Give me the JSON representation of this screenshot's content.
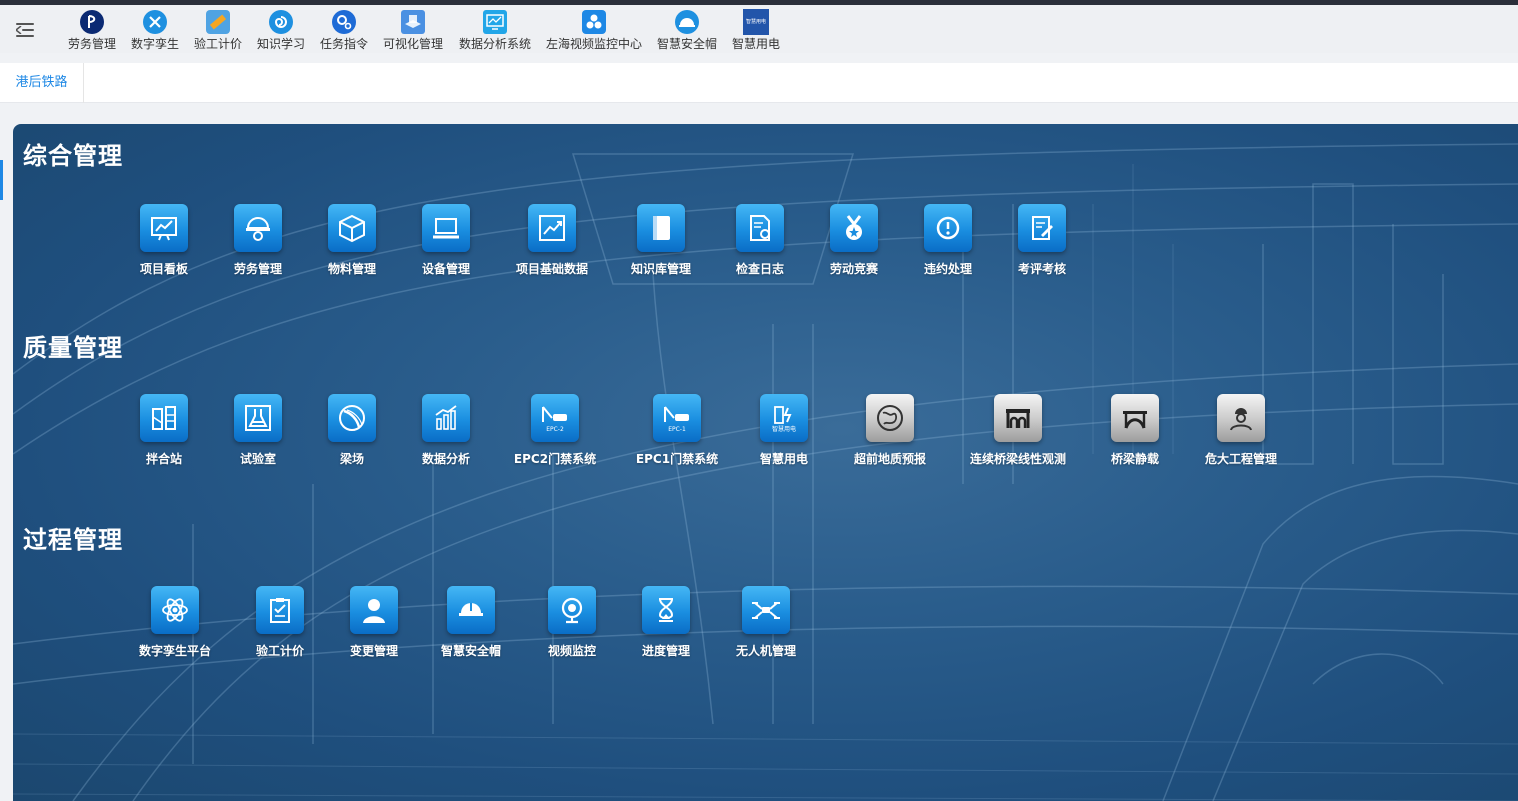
{
  "nav": {
    "items": [
      {
        "label": "劳务管理",
        "icon": "playstation-icon",
        "color": "#0b2a73"
      },
      {
        "label": "数字孪生",
        "icon": "tools-icon",
        "color": "#1e90e0"
      },
      {
        "label": "验工计价",
        "icon": "pencil-ruler-icon",
        "color": "#f5a623"
      },
      {
        "label": "知识学习",
        "icon": "spiral-icon",
        "color": "#1e90e0"
      },
      {
        "label": "任务指令",
        "icon": "gears-icon",
        "color": "#1e6bd6"
      },
      {
        "label": "可视化管理",
        "icon": "cube-city-icon",
        "color": "#4a90e2"
      },
      {
        "label": "数据分析系统",
        "icon": "monitor-chart-icon",
        "color": "#22a6e8"
      },
      {
        "label": "左海视频监控中心",
        "icon": "circles-icon",
        "color": "#1e88e5"
      },
      {
        "label": "智慧安全帽",
        "icon": "helmet-icon",
        "color": "#1e90e0"
      },
      {
        "label": "智慧用电",
        "icon": "power-logo-icon",
        "color": "#2255aa",
        "logo_text": "智慧用电"
      }
    ]
  },
  "tabs": [
    {
      "label": "港后铁路"
    }
  ],
  "sections": [
    {
      "title": "综合管理",
      "apps": [
        {
          "label": "项目看板",
          "icon": "presentation-chart-icon"
        },
        {
          "label": "劳务管理",
          "icon": "worker-helmet-icon"
        },
        {
          "label": "物料管理",
          "icon": "box-icon"
        },
        {
          "label": "设备管理",
          "icon": "laptop-icon"
        },
        {
          "label": "项目基础数据",
          "icon": "trend-chart-icon"
        },
        {
          "label": "知识库管理",
          "icon": "book-icon"
        },
        {
          "label": "检查日志",
          "icon": "document-gear-icon"
        },
        {
          "label": "劳动竞赛",
          "icon": "medal-icon"
        },
        {
          "label": "违约处理",
          "icon": "alert-clock-icon"
        },
        {
          "label": "考评考核",
          "icon": "edit-document-icon"
        }
      ]
    },
    {
      "title": "质量管理",
      "apps": [
        {
          "label": "拌合站",
          "icon": "mixing-plant-icon"
        },
        {
          "label": "试验室",
          "icon": "flask-icon"
        },
        {
          "label": "梁场",
          "icon": "beam-curve-icon"
        },
        {
          "label": "数据分析",
          "icon": "bar-chart-icon"
        },
        {
          "label": "EPC2门禁系统",
          "icon": "gate-car-icon",
          "badge": "EPC-2"
        },
        {
          "label": "EPC1门禁系统",
          "icon": "gate-car-icon",
          "badge": "EPC-1"
        },
        {
          "label": "智慧用电",
          "icon": "smart-power-icon",
          "badge": "智慧用电"
        },
        {
          "label": "超前地质预报",
          "icon": "geology-map-icon",
          "style": "gray"
        },
        {
          "label": "连续桥梁线性观测",
          "icon": "bridge-arch-icon",
          "style": "gray"
        },
        {
          "label": "桥梁静载",
          "icon": "bridge-load-icon",
          "style": "gray"
        },
        {
          "label": "危大工程管理",
          "icon": "engineer-icon",
          "style": "gray"
        }
      ]
    },
    {
      "title": "过程管理",
      "apps": [
        {
          "label": "数字孪生平台",
          "icon": "atom-icon"
        },
        {
          "label": "验工计价",
          "icon": "clipboard-check-icon"
        },
        {
          "label": "变更管理",
          "icon": "person-icon"
        },
        {
          "label": "智慧安全帽",
          "icon": "safety-helmet-icon"
        },
        {
          "label": "视频监控",
          "icon": "webcam-icon"
        },
        {
          "label": "进度管理",
          "icon": "hourglass-icon"
        },
        {
          "label": "无人机管理",
          "icon": "drone-icon"
        }
      ]
    }
  ]
}
